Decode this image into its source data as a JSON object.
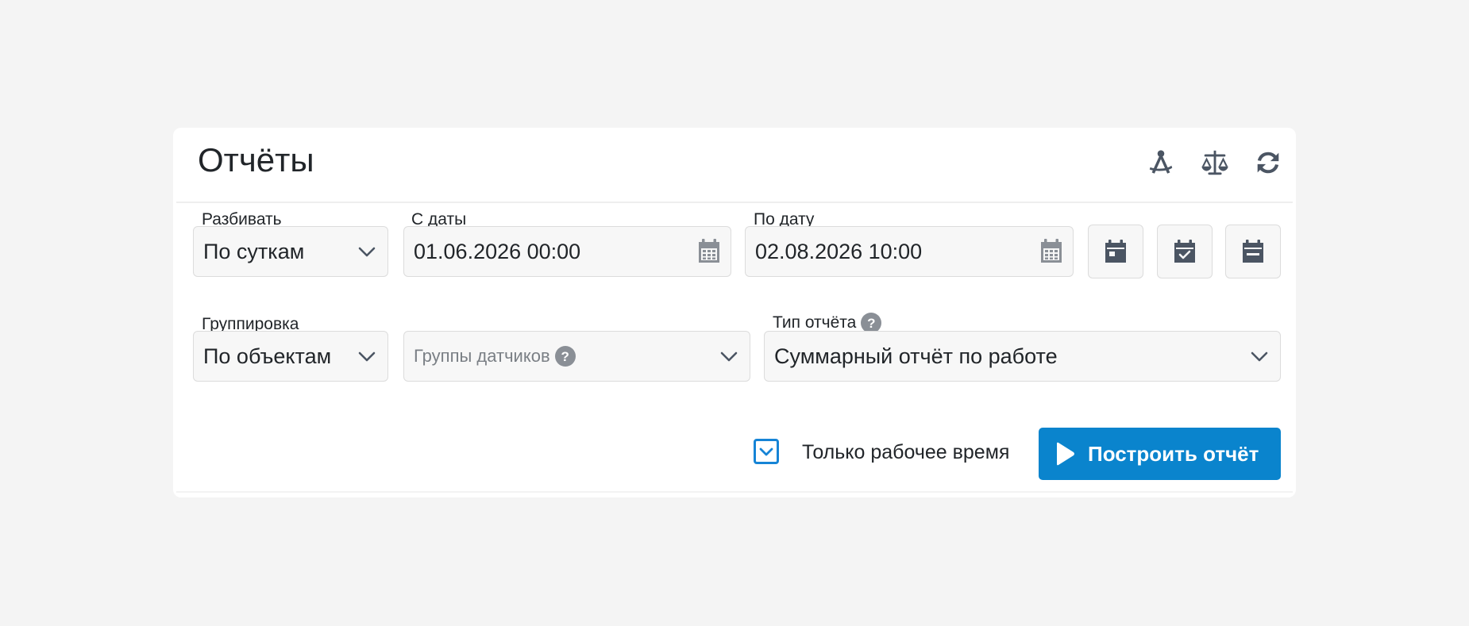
{
  "header": {
    "title": "Отчёты",
    "icons": [
      "compass-icon",
      "scales-icon",
      "refresh-icon"
    ]
  },
  "split": {
    "label": "Разбивать",
    "value": "По суткам"
  },
  "date_from": {
    "label": "С даты",
    "value": "01.06.2026 00:00"
  },
  "date_to": {
    "label": "По дату",
    "value": "02.08.2026 10:00"
  },
  "quick_buttons": [
    "calendar-day-icon",
    "calendar-check-icon",
    "calendar-minus-icon"
  ],
  "grouping": {
    "label": "Группировка",
    "value": "По объектам"
  },
  "sensor_groups": {
    "placeholder": "Группы датчиков"
  },
  "report_type": {
    "label": "Тип отчёта",
    "value": "Суммарный отчёт по работе"
  },
  "work_time_only": {
    "label": "Только рабочее время",
    "checked": true
  },
  "build_button": {
    "label": "Построить отчёт"
  },
  "colors": {
    "accent": "#0a84cd",
    "checkbox": "#1684d6",
    "background": "#f4f4f4"
  }
}
